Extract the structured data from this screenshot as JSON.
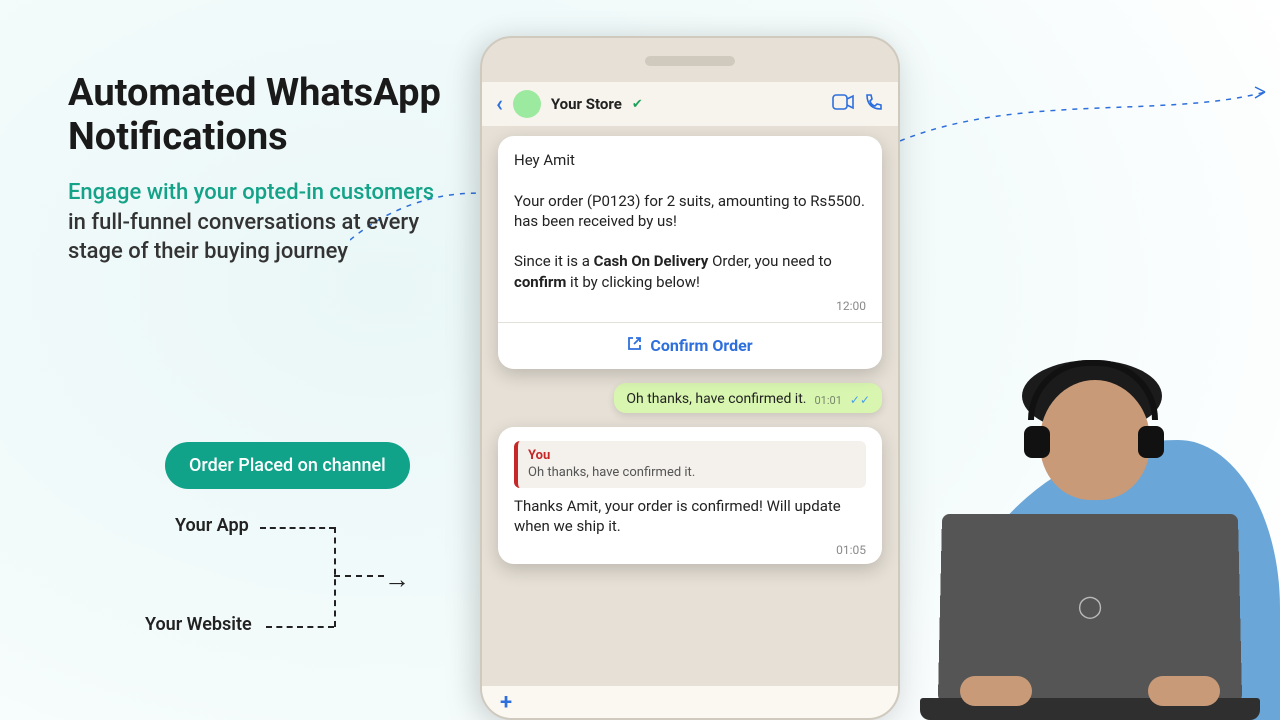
{
  "headline": "Automated WhatsApp Notifications",
  "sub_hl": "Engage with your opted-in customers",
  "sub_rest": " in full-funnel conversations at every stage of their buying journey",
  "channel_pill": "Order Placed on channel",
  "branch_app": "Your App",
  "branch_website": "Your Website",
  "arrowhead": "→",
  "chat": {
    "header": {
      "back": "‹",
      "store": "Your Store",
      "verified": "✔"
    },
    "msg1_p1": "Hey Amit",
    "msg1_p2a": "Your order (P0123) for 2 suits, amounting to Rs5500. has been received by us!",
    "msg1_p3_pre": "Since it is a ",
    "msg1_p3_b1": "Cash On Delivery",
    "msg1_p3_mid": " Order, you need to ",
    "msg1_p3_b2": "confirm",
    "msg1_p3_post": " it by clicking below!",
    "msg1_time": "12:00",
    "confirm_label": "Confirm Order",
    "reply_text": "Oh thanks, have confirmed it.",
    "reply_time": "01:01",
    "reply_ticks": "✓✓",
    "msg2_quote_who": "You",
    "msg2_quote_text": "Oh thanks, have confirmed it.",
    "msg2_body": "Thanks Amit, your order is confirmed! Will update when we ship it.",
    "msg2_time": "01:05"
  }
}
